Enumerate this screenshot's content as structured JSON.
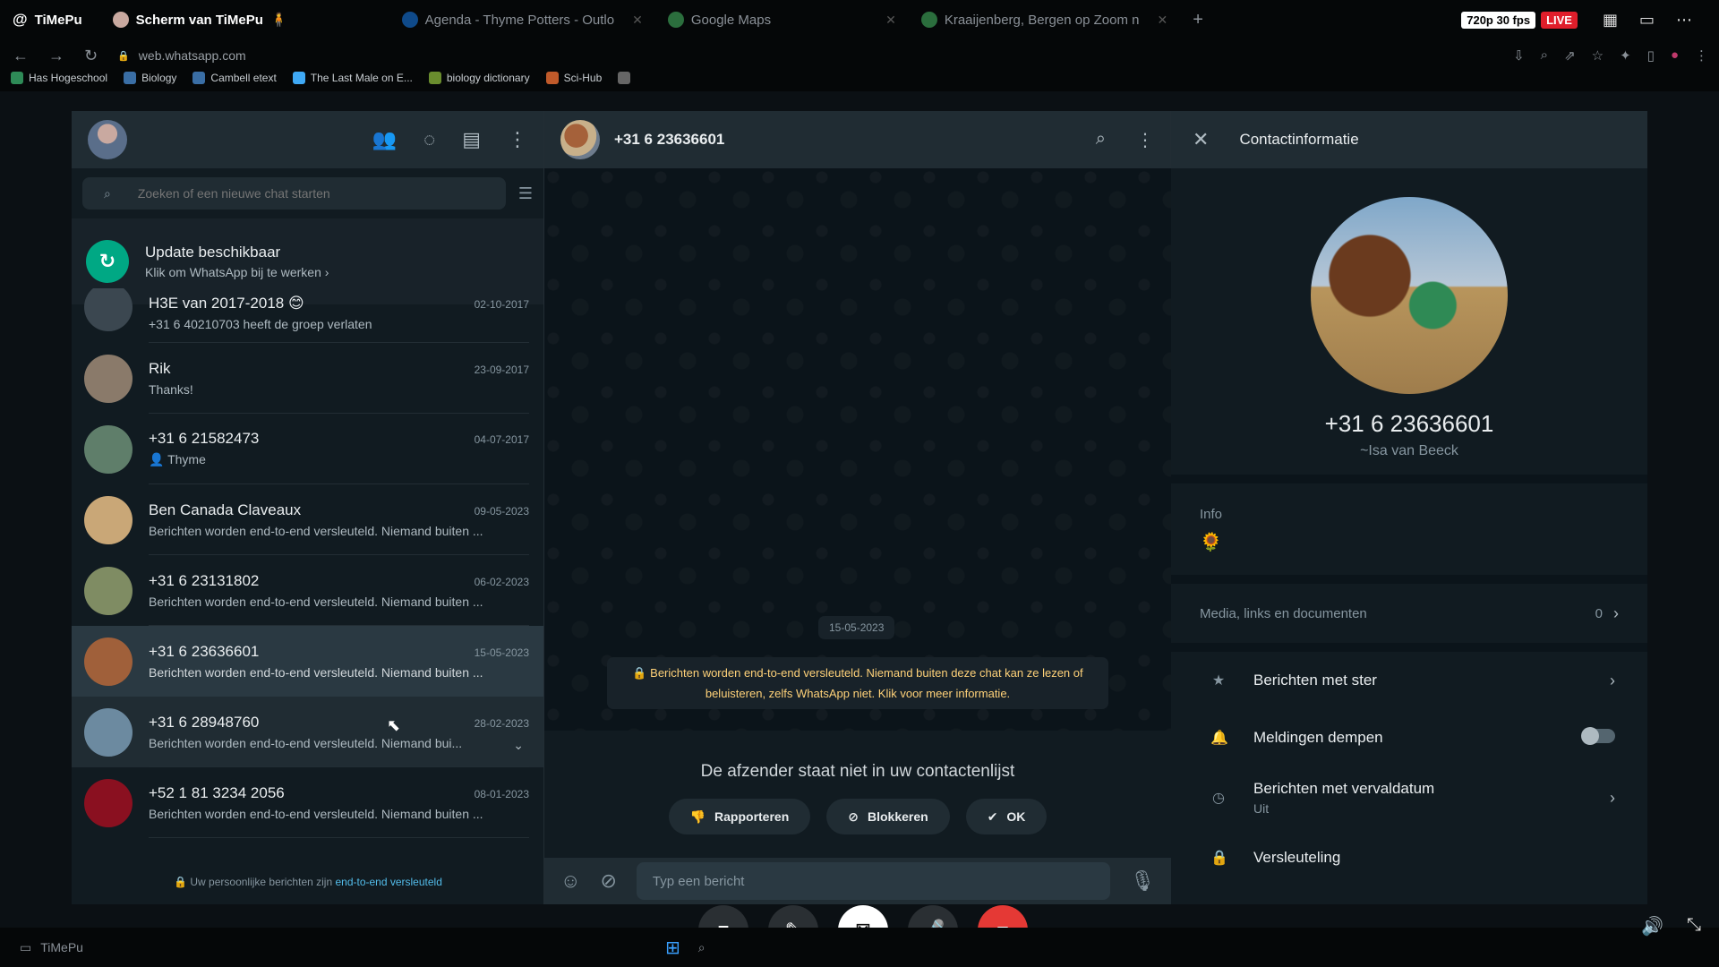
{
  "browser": {
    "tabs": [
      {
        "label": "TiMePu",
        "active": true
      },
      {
        "label": "Scherm van TiMePu",
        "active": true
      },
      {
        "label": "Agenda - Thyme Potters - Outlo",
        "active": false
      },
      {
        "label": "Google Maps",
        "active": false
      },
      {
        "label": "Kraaijenberg, Bergen op Zoom n",
        "active": false
      }
    ],
    "stream_quality": "720p 30 fps",
    "live": "LIVE",
    "url": "web.whatsapp.com",
    "bookmarks": [
      "Has Hogeschool",
      "Biology",
      "Cambell etext",
      "The Last Male on E...",
      "biology dictionary",
      "Sci-Hub"
    ]
  },
  "left": {
    "search_placeholder": "Zoeken of een nieuwe chat starten",
    "update": {
      "title": "Update beschikbaar",
      "subtitle": "Klik om WhatsApp bij te werken ›"
    },
    "chats": [
      {
        "name": "H3E van 2017-2018 😊",
        "date": "02-10-2017",
        "msg": "+31 6 40210703 heeft de groep verlaten",
        "color": "#3b4750"
      },
      {
        "name": "Rik",
        "date": "23-09-2017",
        "msg": "Thanks!",
        "color": "#8a7a6a"
      },
      {
        "name": "+31 6 21582473",
        "date": "04-07-2017",
        "msg": "👤 Thyme",
        "color": "#5f7e6a"
      },
      {
        "name": "Ben Canada Claveaux",
        "date": "09-05-2023",
        "msg": "Berichten worden end-to-end versleuteld. Niemand buiten ...",
        "color": "#c9a777"
      },
      {
        "name": "+31 6 23131802",
        "date": "06-02-2023",
        "msg": "Berichten worden end-to-end versleuteld. Niemand buiten ...",
        "color": "#7f8c63"
      },
      {
        "name": "+31 6 23636601",
        "date": "15-05-2023",
        "msg": "Berichten worden end-to-end versleuteld. Niemand buiten ...",
        "color": "#a0603a",
        "selected": true
      },
      {
        "name": "+31 6 28948760",
        "date": "28-02-2023",
        "msg": "Berichten worden end-to-end versleuteld. Niemand bui...",
        "color": "#6c8aa0"
      },
      {
        "name": "+52 1 81 3234 2056",
        "date": "08-01-2023",
        "msg": "Berichten worden end-to-end versleuteld. Niemand buiten ...",
        "color": "#8a1020"
      }
    ],
    "footer_text": "🔒 Uw persoonlijke berichten zijn ",
    "footer_link": "end-to-end versleuteld"
  },
  "chat": {
    "title": "+31 6 23636601",
    "date_chip": "15-05-2023",
    "encryption_notice": "🔒 Berichten worden end-to-end versleuteld. Niemand buiten deze chat kan ze lezen of beluisteren, zelfs WhatsApp niet. Klik voor meer informatie.",
    "unknown_sender": "De afzender staat niet in uw contactenlijst",
    "btn_report": "Rapporteren",
    "btn_block": "Blokkeren",
    "btn_ok": "OK",
    "composer_placeholder": "Typ een bericht"
  },
  "contact": {
    "header": "Contactinformatie",
    "number": "+31 6 23636601",
    "name": "~Isa van Beeck",
    "info_label": "Info",
    "info_value": "🌻",
    "media_label": "Media, links en documenten",
    "media_count": "0",
    "starred": "Berichten met ster",
    "mute": "Meldingen dempen",
    "disappearing": "Berichten met vervaldatum",
    "disappearing_sub": "Uit",
    "encryption": "Versleuteling"
  },
  "taskbar": {
    "label": "TiMePu"
  }
}
